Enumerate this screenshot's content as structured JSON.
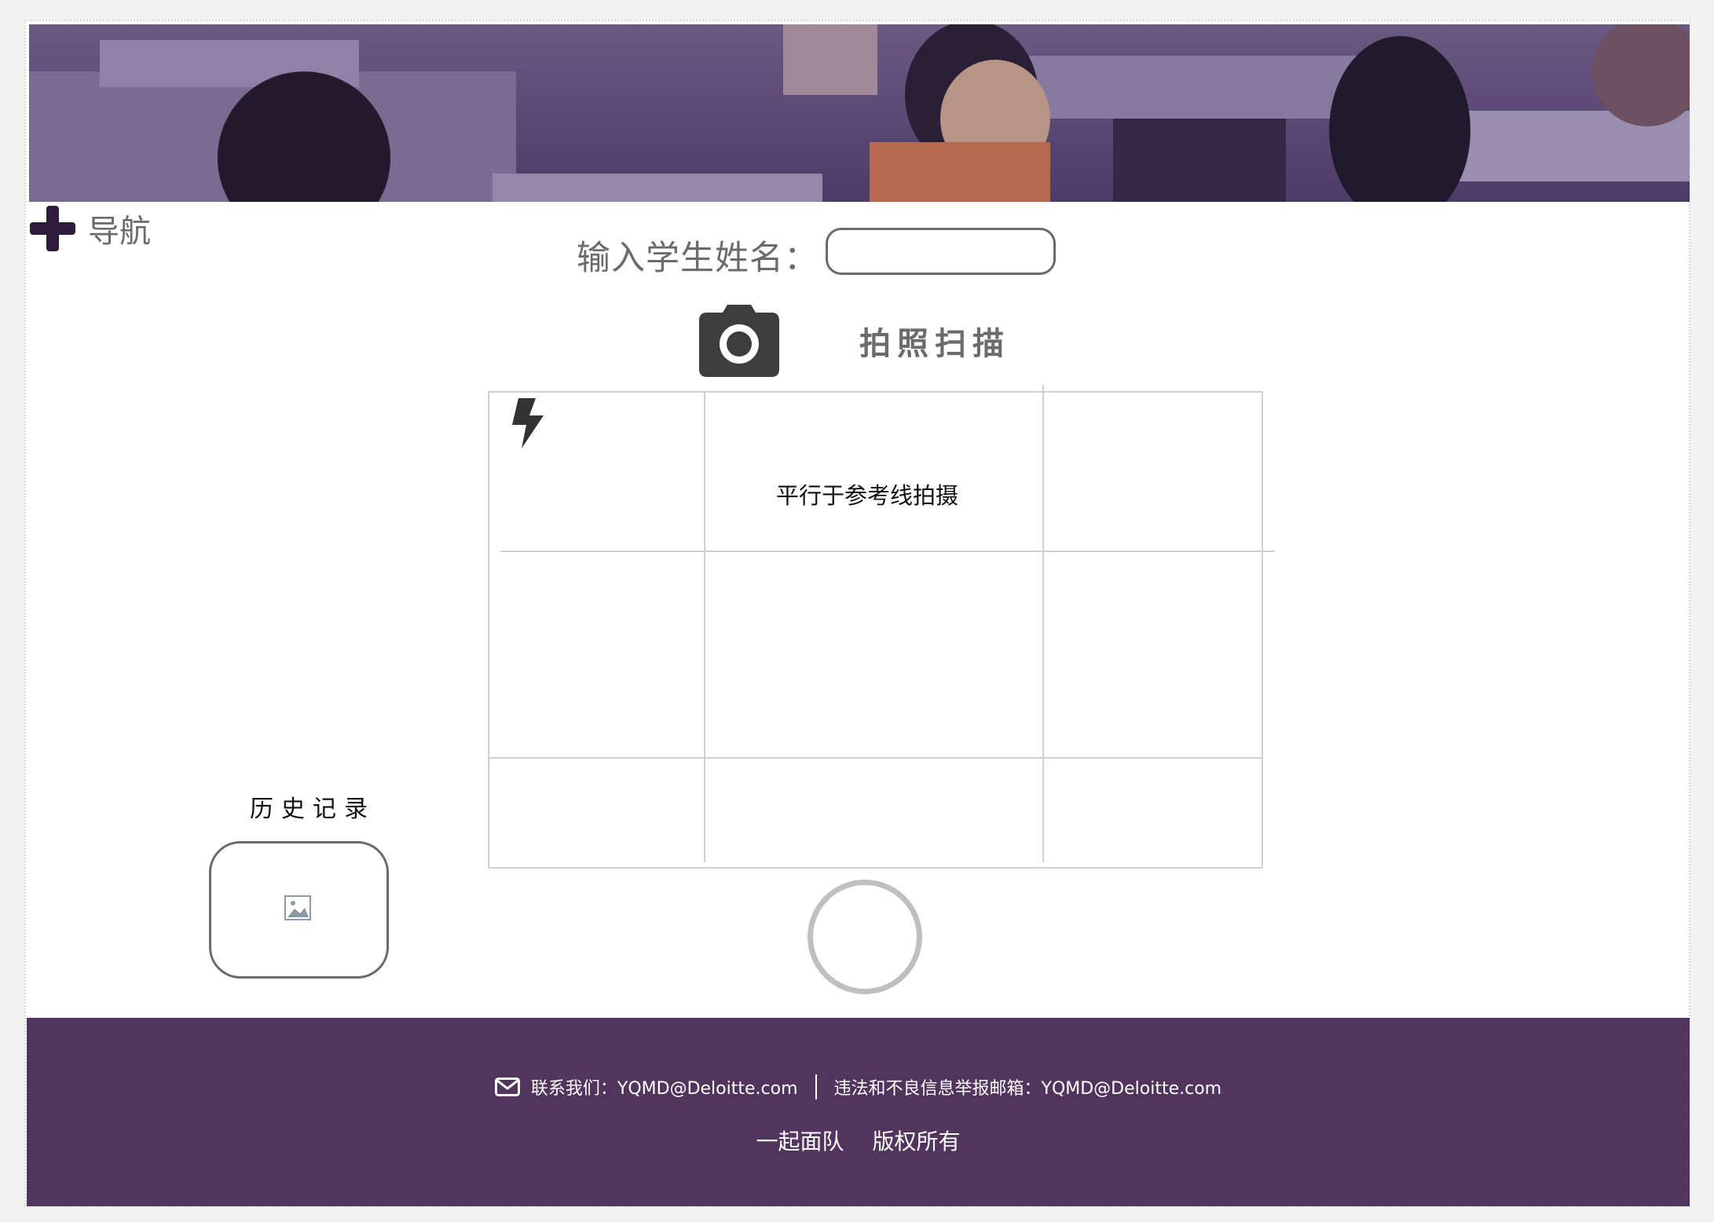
{
  "nav": {
    "label": "导航"
  },
  "form": {
    "name_label": "输入学生姓名：",
    "name_value": "",
    "name_placeholder": ""
  },
  "scan": {
    "label": "拍照扫描",
    "hint": "平行于参考线拍摄"
  },
  "history": {
    "label": "历史记录"
  },
  "footer": {
    "contact": "联系我们：YQMD@Deloitte.com",
    "report": "违法和不良信息举报邮箱：YQMD@Deloitte.com",
    "team": "一起面队",
    "copyright": "版权所有"
  },
  "icons": {
    "nav": "plus-icon",
    "camera": "camera-icon",
    "flash": "flash-icon",
    "thumb": "image-icon",
    "mail": "mail-icon"
  },
  "colors": {
    "footer_bg": "#52355c",
    "banner_tint": "#5a4674",
    "accent": "#2f1b3c"
  }
}
